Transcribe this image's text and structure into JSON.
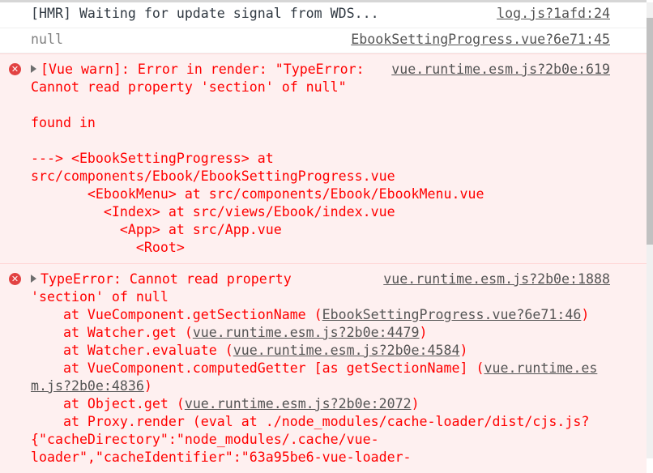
{
  "messages": [
    {
      "type": "log",
      "source": "log.js?1afd:24",
      "lines": [
        [
          {
            "t": "[HMR] Waiting for update signal from WDS..."
          }
        ]
      ]
    },
    {
      "type": "null",
      "source": "EbookSettingProgress.vue?6e71:45",
      "lines": [
        [
          {
            "t": "null"
          }
        ]
      ]
    },
    {
      "type": "err",
      "icon": "error-icon",
      "source": "vue.runtime.esm.js?2b0e:619",
      "lines": [
        [
          {
            "t": "[Vue warn]: Error in render: \"TypeError:"
          }
        ],
        [
          {
            "t": "Cannot read property 'section' of null\""
          }
        ],
        [
          {
            "t": ""
          }
        ],
        [
          {
            "t": "found in"
          }
        ],
        [
          {
            "t": ""
          }
        ],
        [
          {
            "t": "---> <EbookSettingProgress> at"
          }
        ],
        [
          {
            "t": "src/components/Ebook/EbookSettingProgress.vue"
          }
        ],
        [
          {
            "t": "       <EbookMenu> at src/components/Ebook/EbookMenu.vue"
          }
        ],
        [
          {
            "t": "         <Index> at src/views/Ebook/index.vue"
          }
        ],
        [
          {
            "t": "           <App> at src/App.vue"
          }
        ],
        [
          {
            "t": "             <Root>"
          }
        ]
      ]
    },
    {
      "type": "err",
      "icon": "error-icon",
      "source": "vue.runtime.esm.js?2b0e:1888",
      "lines": [
        [
          {
            "t": "TypeError: Cannot read property"
          }
        ],
        [
          {
            "t": "'section' of null"
          }
        ],
        [
          {
            "t": "    at VueComponent.getSectionName ("
          },
          {
            "t": "EbookSettingProgress.vue?6e71:46",
            "link": true
          },
          {
            "t": ")"
          }
        ],
        [
          {
            "t": "    at Watcher.get ("
          },
          {
            "t": "vue.runtime.esm.js?2b0e:4479",
            "link": true
          },
          {
            "t": ")"
          }
        ],
        [
          {
            "t": "    at Watcher.evaluate ("
          },
          {
            "t": "vue.runtime.esm.js?2b0e:4584",
            "link": true
          },
          {
            "t": ")"
          }
        ],
        [
          {
            "t": "    at VueComponent.computedGetter [as getSectionName] ("
          },
          {
            "t": "vue.runtime.es",
            "link": true
          }
        ],
        [
          {
            "t": "m.js?2b0e:4836",
            "link": true
          },
          {
            "t": ")"
          }
        ],
        [
          {
            "t": "    at Object.get ("
          },
          {
            "t": "vue.runtime.esm.js?2b0e:2072",
            "link": true
          },
          {
            "t": ")"
          }
        ],
        [
          {
            "t": "    at Proxy.render (eval at ./node_modules/cache-loader/dist/cjs.js?"
          }
        ],
        [
          {
            "t": "{\"cacheDirectory\":\"node_modules/.cache/vue-"
          }
        ],
        [
          {
            "t": "loader\",\"cacheIdentifier\":\"63a95be6-vue-loader-"
          }
        ]
      ]
    }
  ]
}
